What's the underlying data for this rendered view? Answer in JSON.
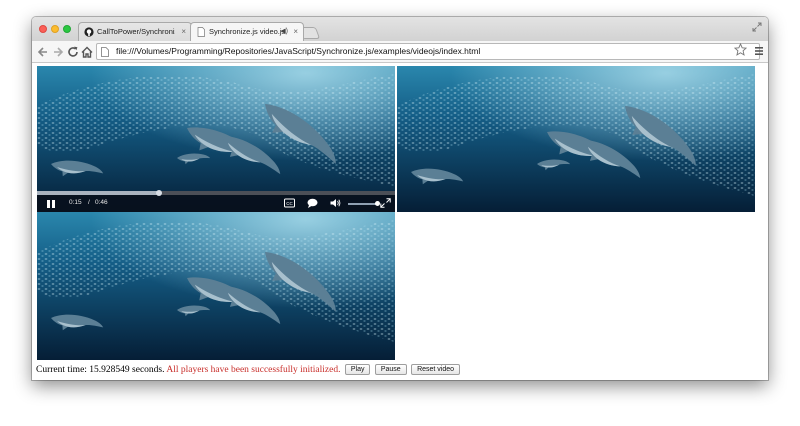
{
  "browser": {
    "tabs": [
      {
        "title": "CallToPower/Synchronize",
        "icon": "github-icon",
        "active": false,
        "close": "×"
      },
      {
        "title": "Synchronize.js video.js",
        "icon": "page-icon",
        "active": true,
        "close": "×",
        "audio": "◀)"
      }
    ],
    "address": "file:///Volumes/Programming/Repositories/JavaScript/Synchronize.js/examples/videojs/index.html",
    "colors": {
      "close": "#fb5f57",
      "minimize": "#fcbc2e",
      "maximize": "#2ac741"
    }
  },
  "players": [
    {
      "id": "player-1",
      "has_controls": true,
      "current_time": "0:15",
      "separator": "/",
      "duration": "0:46",
      "progress_fraction": 0.34,
      "volume_fraction": 0.95,
      "icons": [
        "pause-icon",
        "captions-icon",
        "chapters-icon",
        "volume-icon",
        "fullscreen-icon"
      ]
    },
    {
      "id": "player-2",
      "has_controls": false
    },
    {
      "id": "player-3",
      "has_controls": false
    }
  ],
  "status": {
    "current_time_text": "Current time: 15.928549 seconds.",
    "message": "All players have been successfully initialized.",
    "message_color": "#c9302c"
  },
  "buttons": {
    "play": "Play",
    "pause": "Pause",
    "reset": "Reset video"
  },
  "video_colors": {
    "deep": "#06243d",
    "mid": "#1b6b92",
    "light": "#7fd0ea"
  }
}
